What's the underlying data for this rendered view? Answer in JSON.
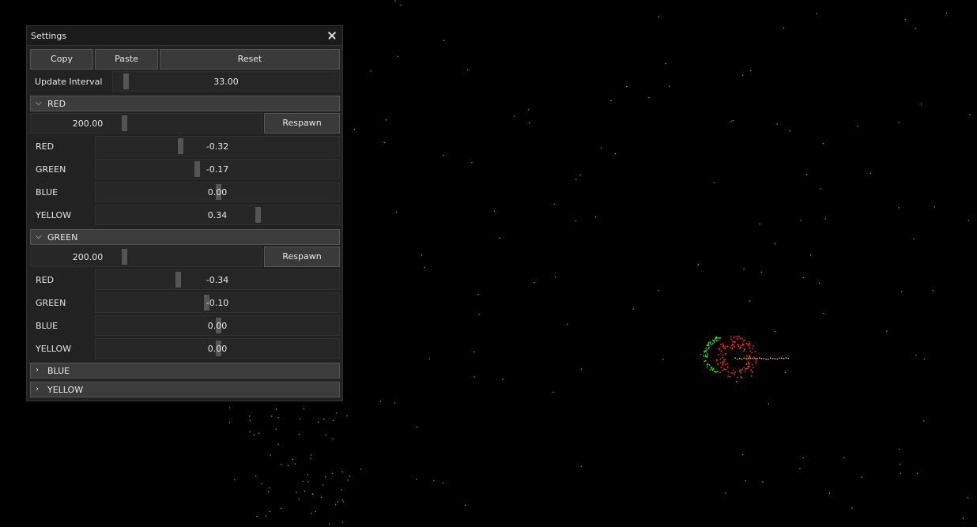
{
  "window": {
    "title": "Settings",
    "close_icon": "close-icon"
  },
  "toolbar": {
    "copy_label": "Copy",
    "paste_label": "Paste",
    "reset_label": "Reset"
  },
  "update_interval": {
    "label": "Update Interval",
    "value": "33.00",
    "level": 0.04
  },
  "groups": [
    {
      "name": "RED",
      "expanded": true,
      "chevron": "chevron-down-icon",
      "count": {
        "value": "200.00",
        "level": 0.4
      },
      "respawn_label": "Respawn",
      "forces": [
        {
          "label": "RED",
          "value": "-0.32",
          "level": 0.34
        },
        {
          "label": "GREEN",
          "value": "-0.17",
          "level": 0.41
        },
        {
          "label": "BLUE",
          "value": "0.00",
          "level": 0.5
        },
        {
          "label": "YELLOW",
          "value": "0.34",
          "level": 0.67
        }
      ]
    },
    {
      "name": "GREEN",
      "expanded": true,
      "chevron": "chevron-down-icon",
      "count": {
        "value": "200.00",
        "level": 0.4
      },
      "respawn_label": "Respawn",
      "forces": [
        {
          "label": "RED",
          "value": "-0.34",
          "level": 0.33
        },
        {
          "label": "GREEN",
          "value": "-0.10",
          "level": 0.45
        },
        {
          "label": "BLUE",
          "value": "0.00",
          "level": 0.5
        },
        {
          "label": "YELLOW",
          "value": "0.00",
          "level": 0.5
        }
      ]
    },
    {
      "name": "BLUE",
      "expanded": false,
      "chevron": "chevron-right-icon"
    },
    {
      "name": "YELLOW",
      "expanded": false,
      "chevron": "chevron-right-icon"
    }
  ],
  "colors": {
    "background": "#000000",
    "panel": "#222222",
    "red_particles": "#ff2a2a",
    "green_particles": "#33dd33",
    "yellow_particles": "#f0e040"
  }
}
